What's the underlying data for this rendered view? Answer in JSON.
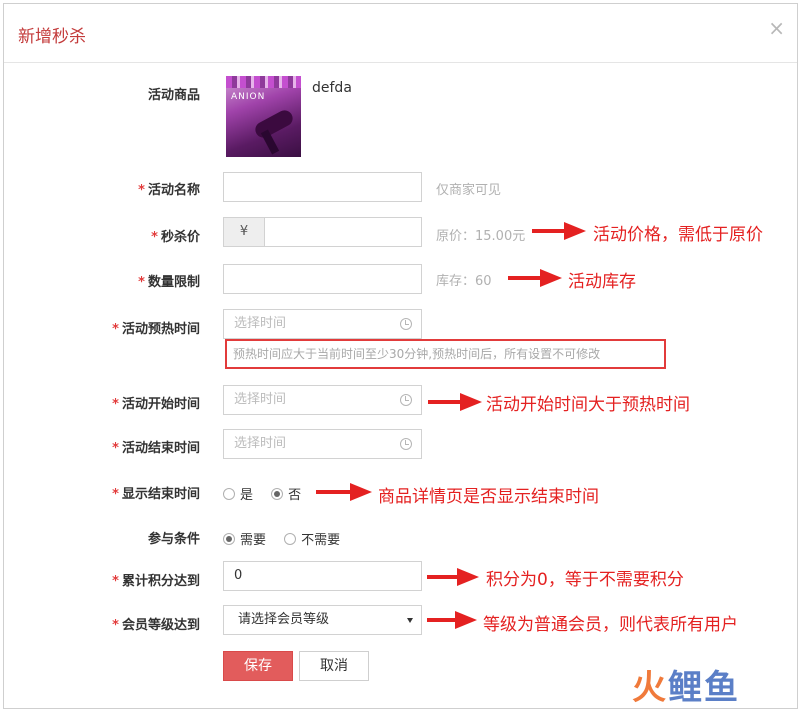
{
  "modal": {
    "title": "新增秒杀",
    "close_glyph": "×"
  },
  "product": {
    "label": "活动商品",
    "image_brand_text": "ANION",
    "name": "defda"
  },
  "fields": {
    "activity_name": {
      "label": "活动名称",
      "value": "",
      "hint": "仅商家可见"
    },
    "seckill_price": {
      "label": "秒杀价",
      "prefix": "¥",
      "value": "",
      "hint": "原价：15.00元"
    },
    "quantity_limit": {
      "label": "数量限制",
      "value": "",
      "hint": "库存：60"
    },
    "preheat_time": {
      "label": "活动预热时间",
      "placeholder": "选择时间"
    },
    "preheat_warning": "预热时间应大于当前时间至少30分钟,预热时间后，所有设置不可修改",
    "start_time": {
      "label": "活动开始时间",
      "placeholder": "选择时间"
    },
    "end_time": {
      "label": "活动结束时间",
      "placeholder": "选择时间"
    },
    "show_end_time": {
      "label": "显示结束时间",
      "options": [
        "是",
        "否"
      ],
      "selected": "否"
    },
    "condition": {
      "label": "参与条件",
      "options": [
        "需要",
        "不需要"
      ],
      "selected": "需要"
    },
    "points": {
      "label": "累计积分达到",
      "value": "0"
    },
    "member_level": {
      "label": "会员等级达到",
      "selected_text": "请选择会员等级"
    }
  },
  "required_mark": "*",
  "buttons": {
    "save": "保存",
    "cancel": "取消"
  },
  "annotations": {
    "price": "活动价格，需低于原价",
    "stock": "活动库存",
    "start": "活动开始时间大于预热时间",
    "show_end": "商品详情页是否显示结束时间",
    "points": "积分为0，等于不需要积分",
    "level": "等级为普通会员，则代表所有用户"
  },
  "watermark": {
    "part1": "火",
    "part2": "鲤鱼"
  },
  "colors": {
    "title_red": "#c33a3a",
    "annotation_red": "#e42121",
    "save_button": "#e25c5c"
  }
}
